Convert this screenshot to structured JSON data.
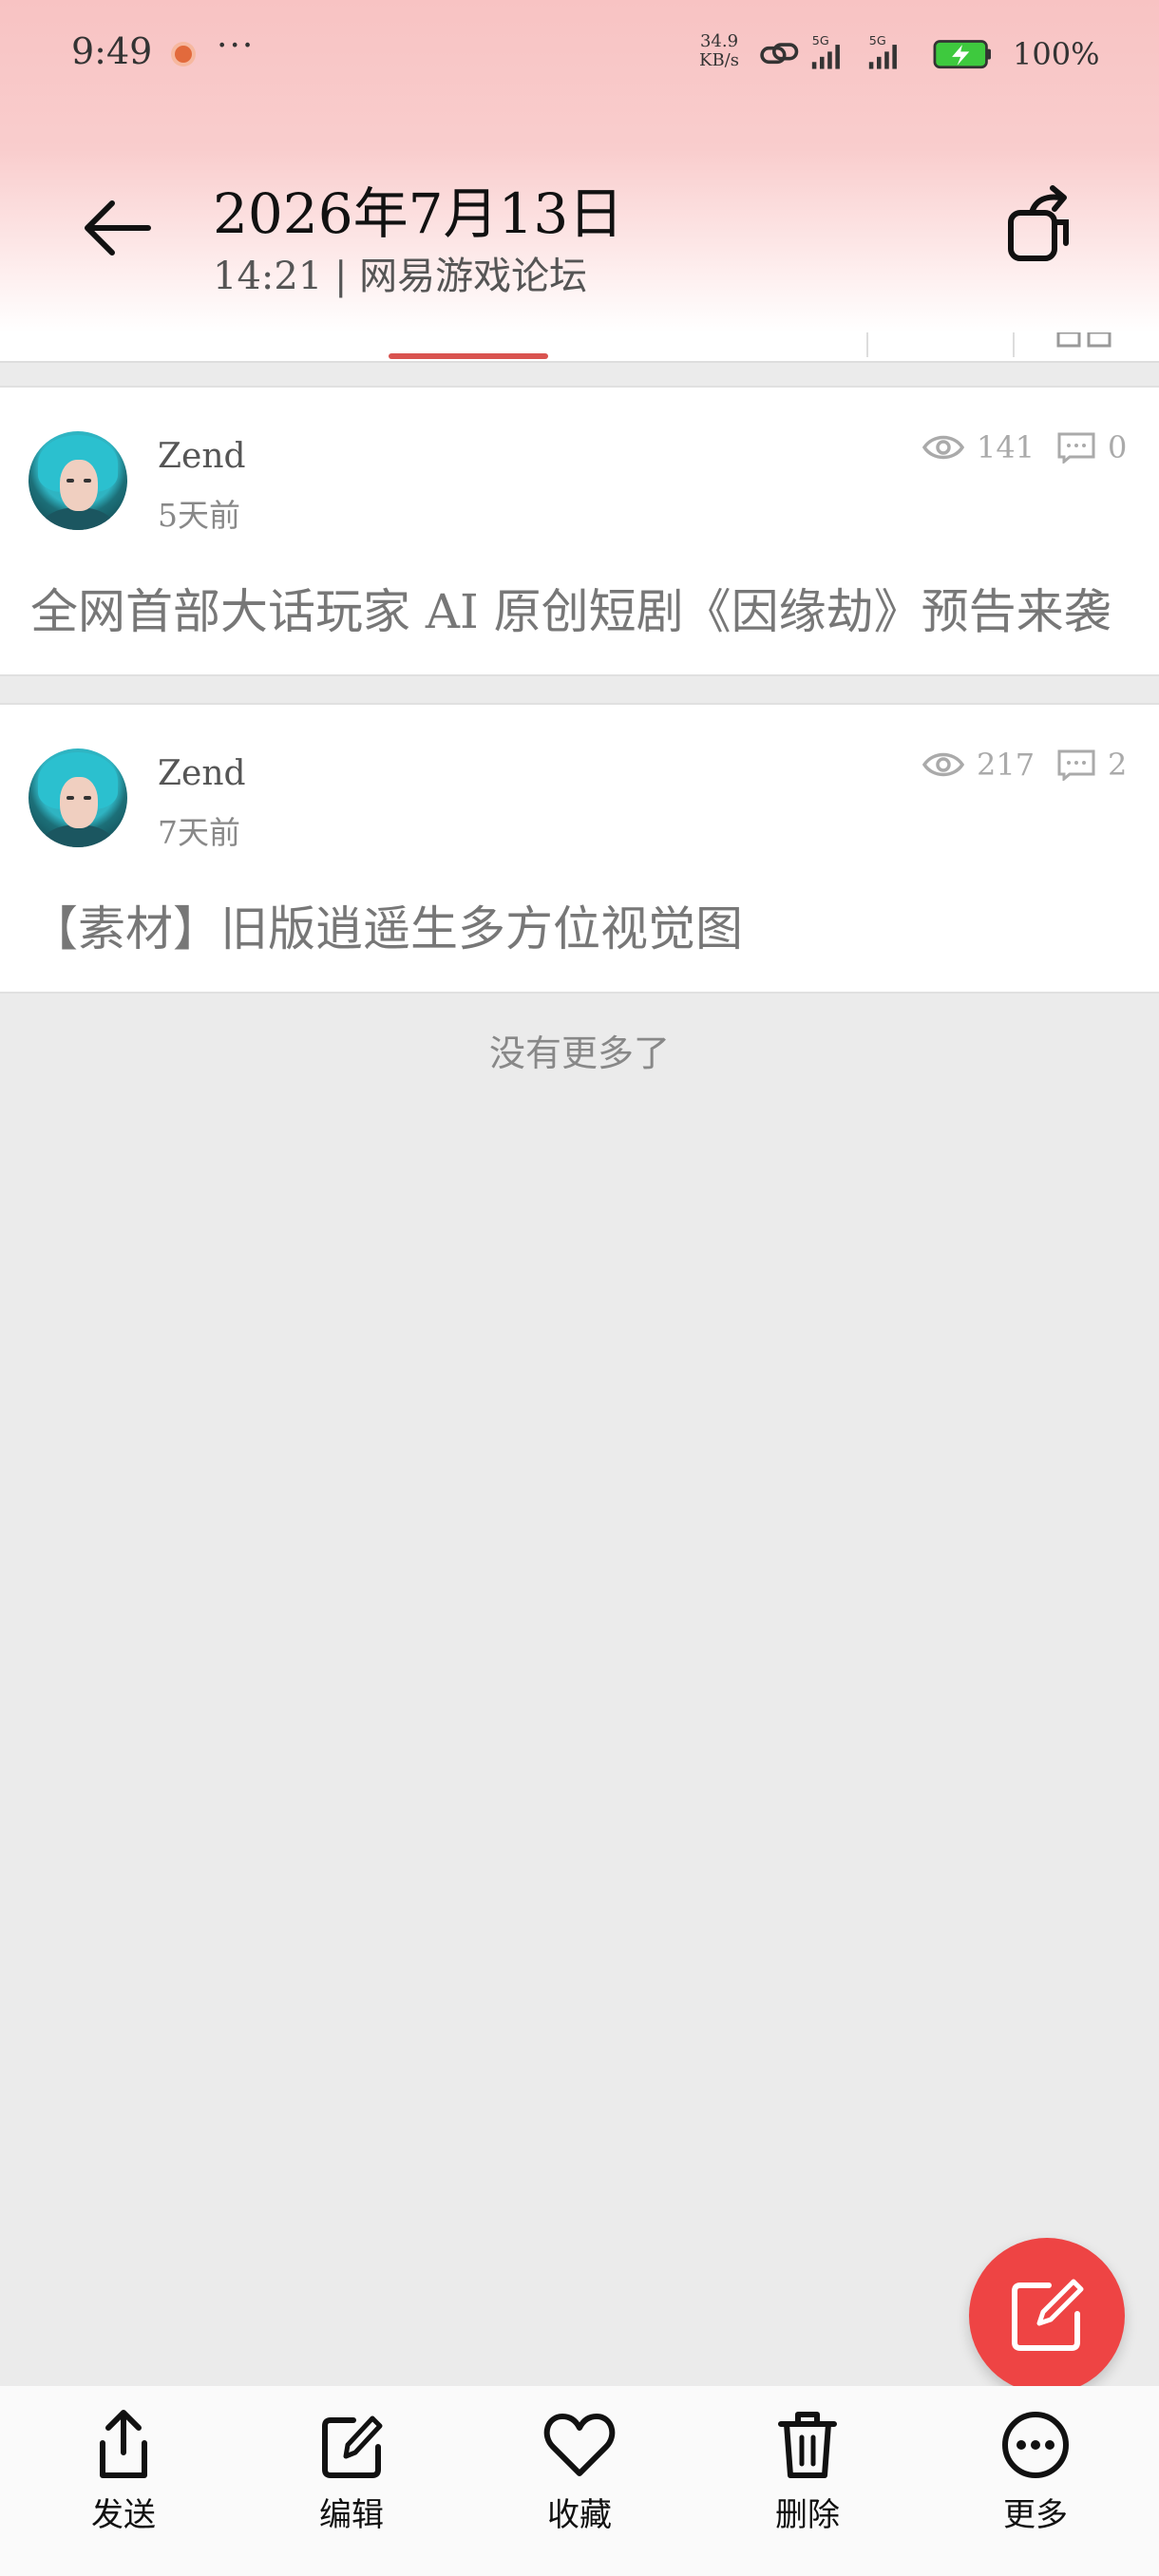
{
  "status_bar": {
    "time": "9:49",
    "more": "···",
    "net_speed_value": "34.9",
    "net_speed_unit": "KB/s",
    "signal_label_1": "5G",
    "signal_label_2": "5G",
    "battery": "100%"
  },
  "header": {
    "title": "2026年7月13日",
    "subtitle": "14:21 | 网易游戏论坛"
  },
  "posts": [
    {
      "author": "Zend",
      "time_ago": "5天前",
      "views": "141",
      "comments": "0",
      "title": "全网首部大话玩家 AI 原创短剧《因缘劫》预告来袭"
    },
    {
      "author": "Zend",
      "time_ago": "7天前",
      "views": "217",
      "comments": "2",
      "title": "【素材】旧版逍遥生多方位视觉图"
    }
  ],
  "list_footer": "没有更多了",
  "bottom_bar": {
    "send": "发送",
    "edit": "编辑",
    "favorite": "收藏",
    "delete": "删除",
    "more": "更多"
  },
  "colors": {
    "accent": "#ee4444",
    "tab_indicator": "#d9534f",
    "header_gradient_top": "#f8c3c3"
  },
  "icons": [
    "back-arrow-icon",
    "share-icon",
    "eye-icon",
    "comment-icon",
    "compose-icon",
    "upload-icon",
    "edit-icon",
    "heart-icon",
    "trash-icon",
    "more-icon"
  ]
}
